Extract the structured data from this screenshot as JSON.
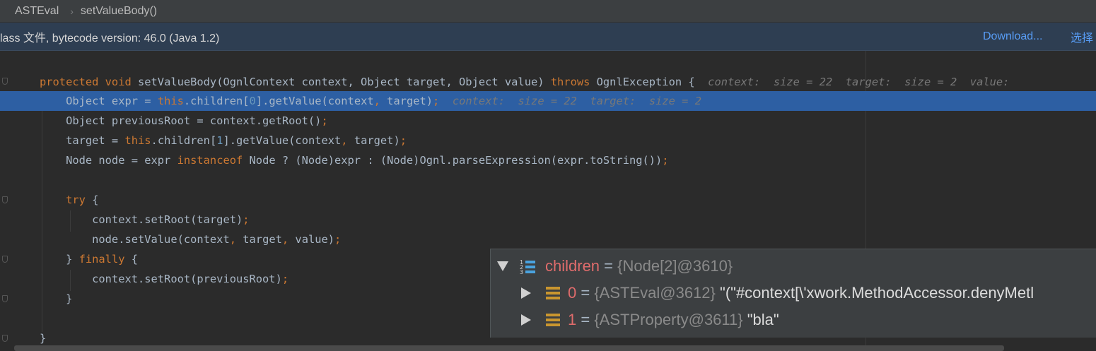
{
  "breadcrumb": {
    "class_name": "ASTEval",
    "separator": "›",
    "method": "setValueBody()"
  },
  "banner": {
    "message": "lass 文件, bytecode version: 46.0 (Java 1.2)",
    "download_label": "Download...",
    "choose_label": "选择"
  },
  "colors": {
    "keyword": "#cc7832",
    "number": "#6897bb",
    "current_line": "#2d5fa3",
    "popup_var": "#e06c6c"
  },
  "code": {
    "l1": {
      "a": "protected void ",
      "m": "setValueBody(OgnlContext context, Object target, Object value) ",
      "k": "throws ",
      "e": "OgnlException {",
      "hint": "  context:  size = 22  target:  size = 2  value:"
    },
    "l2": {
      "a": "    Object expr = ",
      "k": "this",
      "b": ".children[",
      "n": "0",
      "c": "].getValue(context",
      "sep": ", ",
      "d": "target)",
      "semi": ";",
      "hint": "  context:  size = 22  target:  size = 2"
    },
    "l3": {
      "text": "    Object previousRoot = context.getRoot()",
      "semi": ";"
    },
    "l4": {
      "a": "    target = ",
      "k": "this",
      "b": ".children[",
      "n": "1",
      "c": "].getValue(context",
      "sep": ", ",
      "d": "target)",
      "semi": ";"
    },
    "l5": {
      "a": "    Node node = expr ",
      "k": "instanceof",
      "b": " Node ? (Node)expr : (Node)Ognl.parseExpression(expr.toString())",
      "semi": ";"
    },
    "l7": {
      "k": "    try",
      "b": " {"
    },
    "l8": {
      "text": "        context.setRoot(target)",
      "semi": ";"
    },
    "l9": {
      "a": "        node.setValue(context",
      "sep1": ", ",
      "b": "target",
      "sep2": ", ",
      "c": "value)",
      "semi": ";"
    },
    "l10": {
      "a": "    } ",
      "k": "finally",
      "b": " {"
    },
    "l11": {
      "text": "        context.setRoot(previousRoot)",
      "semi": ";"
    },
    "l12": {
      "text": "    }"
    },
    "l14": {
      "text": "}"
    }
  },
  "popup": {
    "root": {
      "name": "children",
      "eq": " = ",
      "type": "{Node[2]@3610}",
      "icon": "array-icon"
    },
    "items": [
      {
        "name": "0",
        "eq": " = ",
        "type": "{ASTEval@3612}",
        "value": " \"(\"#context[\\'xwork.MethodAccessor.denyMetl",
        "icon": "field-icon"
      },
      {
        "name": "1",
        "eq": " = ",
        "type": "{ASTProperty@3611}",
        "value": " \"bla\"",
        "icon": "field-icon"
      }
    ]
  }
}
